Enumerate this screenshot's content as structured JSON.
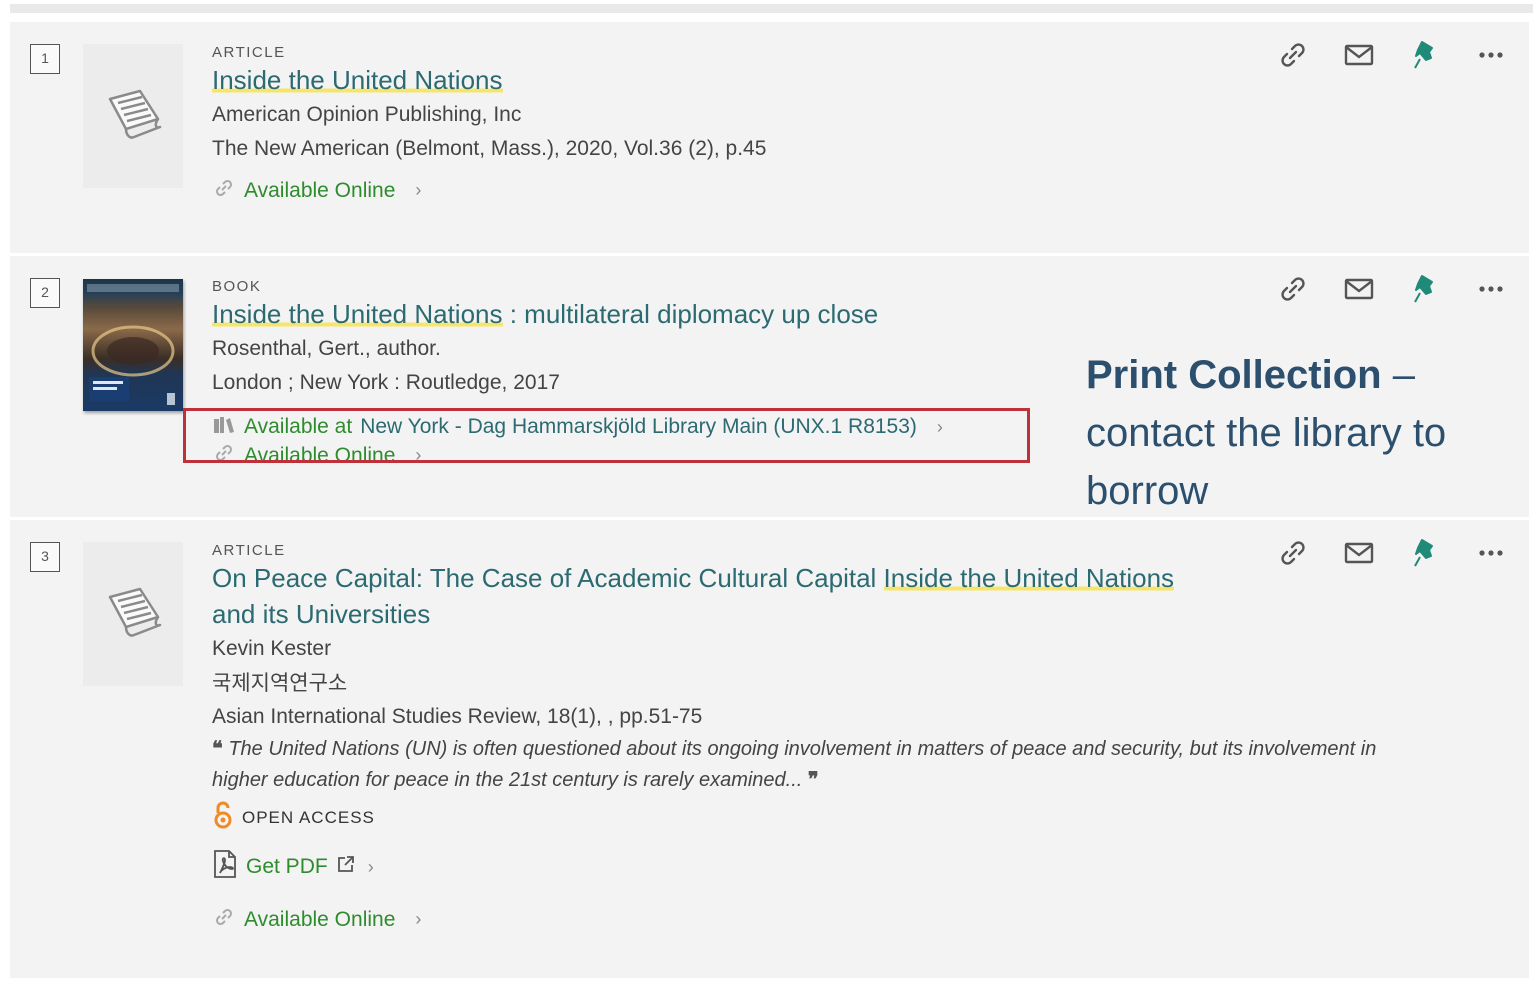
{
  "results": [
    {
      "index": "1",
      "type": "ARTICLE",
      "title_highlight": "Inside the United Nations",
      "publisher": "American Opinion Publishing, Inc",
      "source": "The New American (Belmont, Mass.), 2020, Vol.36 (2), p.45",
      "availability": "Available Online"
    },
    {
      "index": "2",
      "type": "BOOK",
      "title_highlight": "Inside the United Nations",
      "title_rest": " : multilateral diplomacy up close",
      "author": "Rosenthal, Gert., author.",
      "publication": "London ; New York : Routledge, 2017",
      "available_at_label": "Available at",
      "location": "New York - Dag Hammarskjöld Library  Main (UNX.1 R8153)",
      "availability": "Available Online"
    },
    {
      "index": "3",
      "type": "ARTICLE",
      "title_prefix": "On Peace Capital: The Case of Academic Cultural Capital ",
      "title_highlight": "Inside the United Nations",
      "title_line2": "and its Universities",
      "author": "Kevin Kester",
      "org": "국제지역연구소",
      "source": "Asian International Studies Review, 18(1), , pp.51-75",
      "abstract": "The United Nations (UN) is often questioned about its ongoing involvement in matters of peace and security, but its involvement in higher education for peace in the 21st century is rarely examined...",
      "open_access": "OPEN ACCESS",
      "get_pdf": "Get PDF",
      "availability": "Available Online"
    }
  ],
  "callout": {
    "bold": "Print Collection",
    "rest": " – contact the library to borrow"
  },
  "colors": {
    "title": "#2c6a72",
    "available": "#2e8b2e",
    "highlight": "#f7e46b",
    "pin": "#1f8a78",
    "annotation_box": "#c0303a",
    "callout_text": "#2c4f6e"
  },
  "icons": [
    "link-icon",
    "envelope-icon",
    "pin-icon",
    "more-icon",
    "chevron-right-icon",
    "book-icon",
    "open-access-icon",
    "pdf-icon",
    "external-link-icon",
    "quote-icon"
  ]
}
